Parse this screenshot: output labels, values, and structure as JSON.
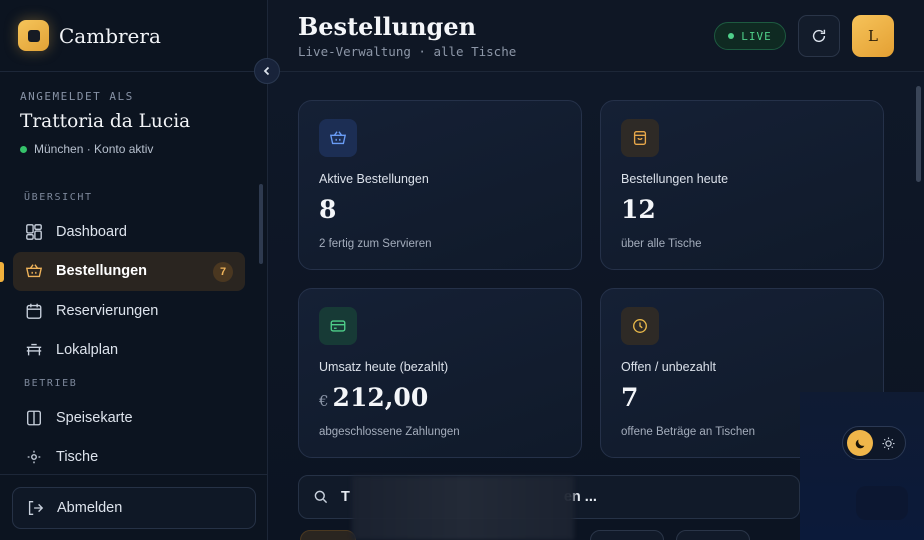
{
  "brand": {
    "name": "Cambrera"
  },
  "account": {
    "label": "ANGEMELDET ALS",
    "name": "Trattoria da Lucia",
    "status": "München · Konto aktiv"
  },
  "nav": {
    "section_overview": "ÜBERSICHT",
    "section_operations": "BETRIEB",
    "items": [
      {
        "label": "Dashboard",
        "icon": "dashboard-icon"
      },
      {
        "label": "Bestellungen",
        "icon": "basket-icon",
        "badge": "7",
        "active": true
      },
      {
        "label": "Reservierungen",
        "icon": "calendar-icon"
      },
      {
        "label": "Lokalplan",
        "icon": "table-icon"
      },
      {
        "label": "Speisekarte",
        "icon": "menu-book-icon"
      },
      {
        "label": "Tische",
        "icon": "tables-icon"
      }
    ],
    "logout": "Abmelden"
  },
  "header": {
    "title": "Bestellungen",
    "subtitle": "Live-Verwaltung · alle Tische",
    "live": "LIVE",
    "avatar_initial": "L"
  },
  "cards": [
    {
      "label": "Aktive Bestellungen",
      "value": "8",
      "sub": "2 fertig zum Servieren",
      "icon": "basket-icon",
      "accent": "#5b8ff0"
    },
    {
      "label": "Bestellungen heute",
      "value": "12",
      "sub": "über alle Tische",
      "icon": "bag-icon",
      "accent": "#e8a84a"
    },
    {
      "label": "Umsatz heute (bezahlt)",
      "currency": "€",
      "value": "212,00",
      "sub": "abgeschlossene Zahlungen",
      "icon": "card-icon",
      "accent": "#4fd08a"
    },
    {
      "label": "Offen / unbezahlt",
      "value": "7",
      "sub": "offene Beträge an Tischen",
      "icon": "clock-icon",
      "accent": "#e8b84a"
    }
  ],
  "search": {
    "visible_text_start": "T",
    "visible_text_end": "en ..."
  },
  "colors": {
    "accent": "#f0b03c",
    "live_green": "#4fd08a",
    "background": "#0e1623"
  }
}
